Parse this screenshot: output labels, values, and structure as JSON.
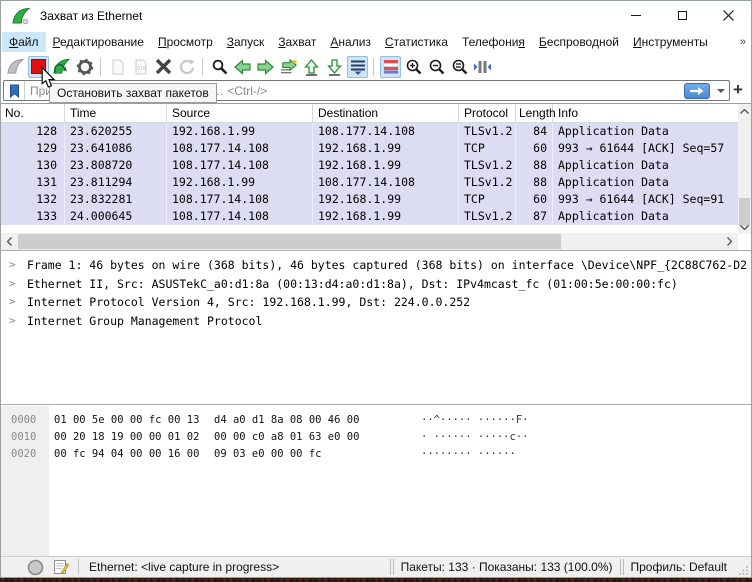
{
  "window": {
    "title": "Захват из Ethernet"
  },
  "menu": {
    "overflow": "»",
    "items": [
      {
        "label": "Файл",
        "accel": "Ф",
        "active": true
      },
      {
        "label": "Редактирование",
        "accel": "Р"
      },
      {
        "label": "Просмотр",
        "accel": "П"
      },
      {
        "label": "Запуск",
        "accel": "З"
      },
      {
        "label": "Захват",
        "accel": "З"
      },
      {
        "label": "Анализ",
        "accel": "А"
      },
      {
        "label": "Статистика",
        "accel": "С"
      },
      {
        "label": "Телефония",
        "accel": "я"
      },
      {
        "label": "Беспроводной",
        "accel": "Б"
      },
      {
        "label": "Инструменты",
        "accel": "И"
      }
    ]
  },
  "toolbar": {
    "tooltip": "Остановить захват пакетов",
    "icons": [
      "start-capture",
      "stop-capture",
      "restart-capture",
      "capture-options",
      "open-file",
      "save-file",
      "close-file",
      "reload-file",
      "find-packet",
      "previous-packet",
      "next-packet",
      "go-to-packet",
      "first-packet",
      "last-packet",
      "auto-scroll",
      "colorize-packets",
      "zoom-in",
      "zoom-out",
      "zoom-original",
      "resize-columns"
    ]
  },
  "filter": {
    "placeholder": "Примените дисплейный фильтр … <Ctrl-/>",
    "add_button": "+"
  },
  "packet_list": {
    "columns": {
      "no": "No.",
      "time": "Time",
      "source": "Source",
      "destination": "Destination",
      "protocol": "Protocol",
      "length": "Length",
      "info": "Info"
    },
    "rows": [
      {
        "no": "128",
        "time": "23.620255",
        "source": "192.168.1.99",
        "destination": "108.177.14.108",
        "protocol": "TLSv1.2",
        "length": "84",
        "info": "Application Data"
      },
      {
        "no": "129",
        "time": "23.641086",
        "source": "108.177.14.108",
        "destination": "192.168.1.99",
        "protocol": "TCP",
        "length": "60",
        "info": "993 → 61644 [ACK] Seq=57"
      },
      {
        "no": "130",
        "time": "23.808720",
        "source": "108.177.14.108",
        "destination": "192.168.1.99",
        "protocol": "TLSv1.2",
        "length": "88",
        "info": "Application Data"
      },
      {
        "no": "131",
        "time": "23.811294",
        "source": "192.168.1.99",
        "destination": "108.177.14.108",
        "protocol": "TLSv1.2",
        "length": "88",
        "info": "Application Data"
      },
      {
        "no": "132",
        "time": "23.832281",
        "source": "108.177.14.108",
        "destination": "192.168.1.99",
        "protocol": "TCP",
        "length": "60",
        "info": "993 → 61644 [ACK] Seq=91"
      },
      {
        "no": "133",
        "time": "24.000645",
        "source": "108.177.14.108",
        "destination": "192.168.1.99",
        "protocol": "TLSv1.2",
        "length": "87",
        "info": "Application Data"
      }
    ]
  },
  "details": {
    "expander": ">",
    "lines": [
      "Frame 1: 46 bytes on wire (368 bits), 46 bytes captured (368 bits) on interface \\Device\\NPF_{2C88C762-D2",
      "Ethernet II, Src: ASUSTekC_a0:d1:8a (00:13:d4:a0:d1:8a), Dst: IPv4mcast_fc (01:00:5e:00:00:fc)",
      "Internet Protocol Version 4, Src: 192.168.1.99, Dst: 224.0.0.252",
      "Internet Group Management Protocol"
    ]
  },
  "hex_dump": {
    "rows": [
      {
        "offset": "0000",
        "hex1": "01 00 5e 00 00 fc 00 13",
        "hex2": "d4 a0 d1 8a 08 00 46 00",
        "ascii": "··^····· ······F·"
      },
      {
        "offset": "0010",
        "hex1": "00 20 18 19 00 00 01 02",
        "hex2": "00 00 c0 a8 01 63 e0 00",
        "ascii": "· ······ ·····c··"
      },
      {
        "offset": "0020",
        "hex1": "00 fc 94 04 00 00 16 00",
        "hex2": "09 03 e0 00 00 fc",
        "ascii": "········ ······"
      }
    ]
  },
  "status_bar": {
    "capture_info": "Ethernet: <live capture in progress>",
    "packets_info": "Пакеты: 133 · Показаны: 133 (100.0%)",
    "profile": "Профиль: Default"
  },
  "colors": {
    "accent_blue": "#4a88d4",
    "row_lavender": "#dfdff2",
    "stop_red": "#e01010"
  }
}
